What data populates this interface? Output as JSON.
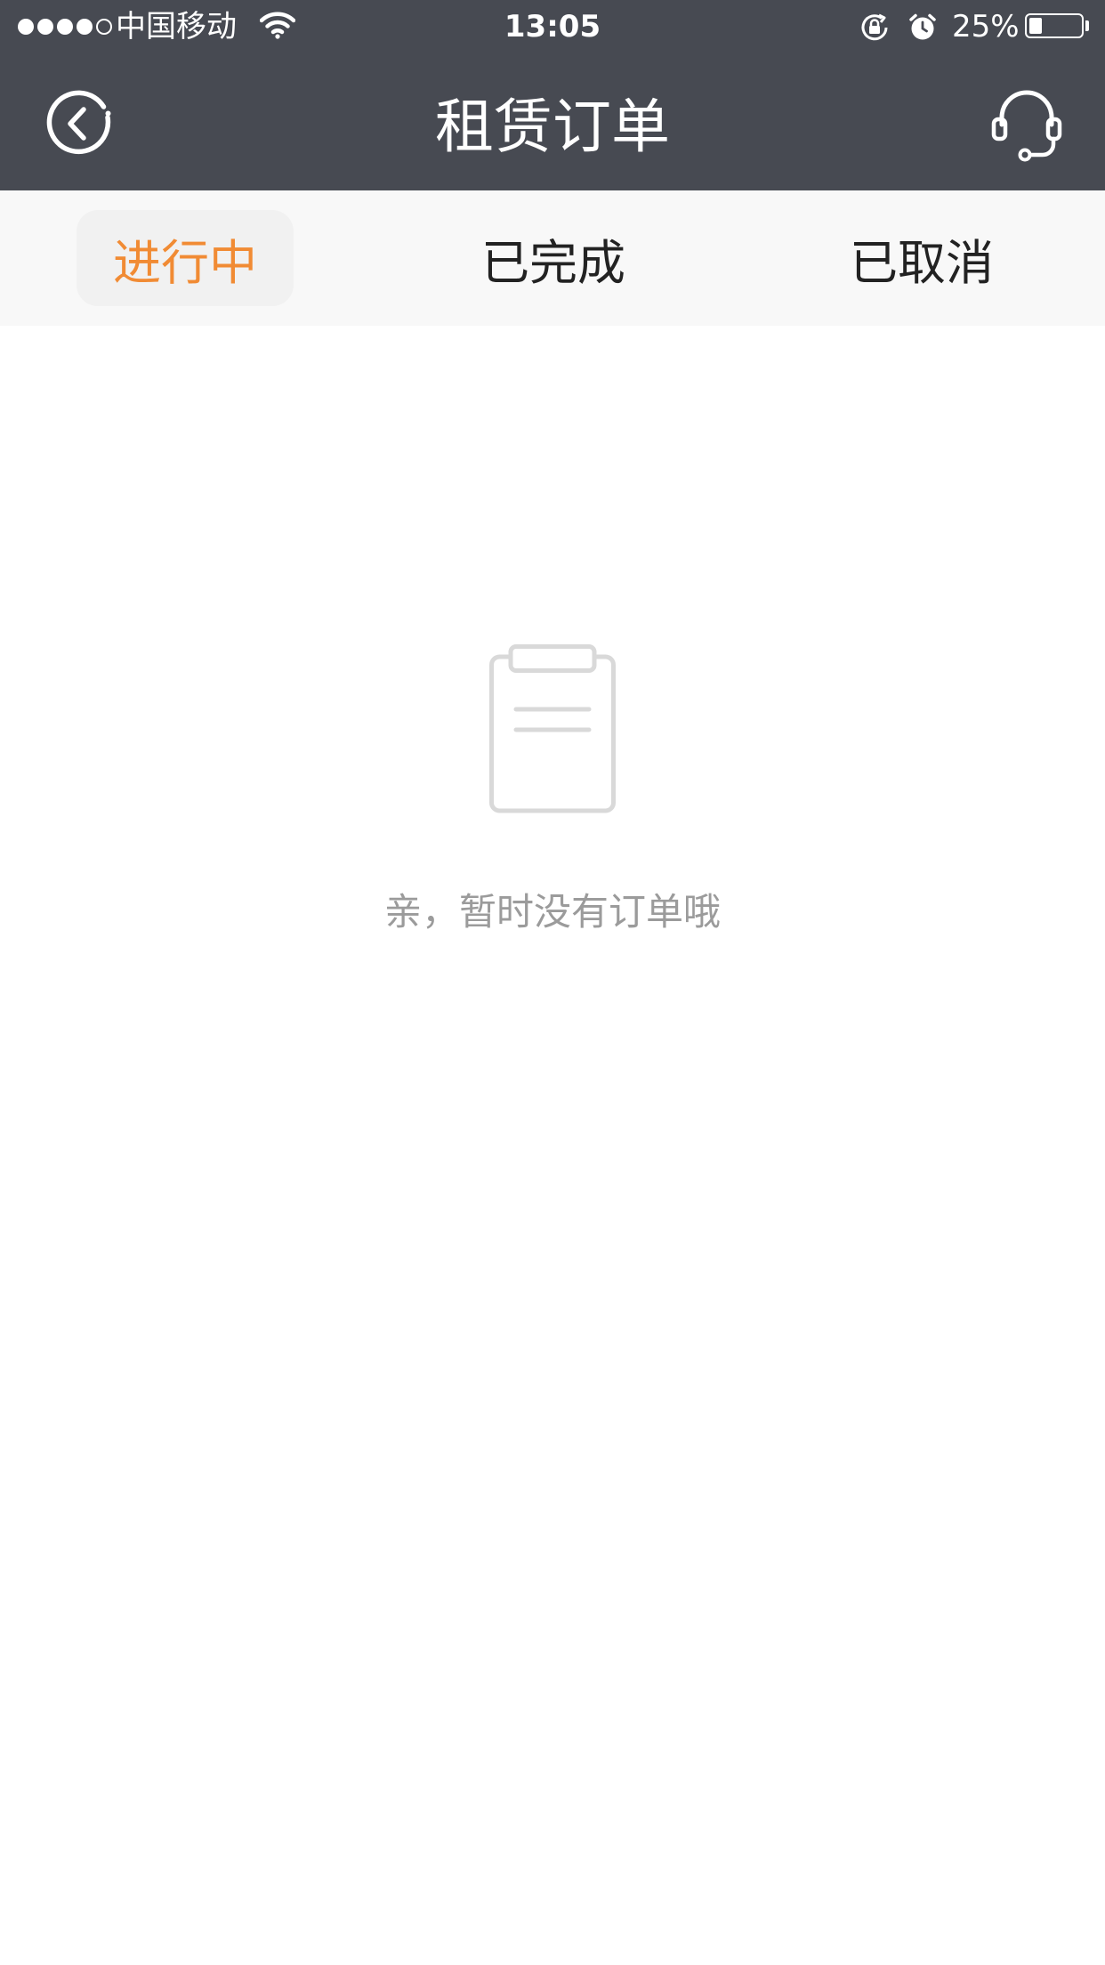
{
  "status_bar": {
    "carrier": "中国移动",
    "time": "13:05",
    "battery_percent": "25%",
    "battery_level": 0.25,
    "signal_bars_filled": 4,
    "signal_bars_total": 5
  },
  "nav": {
    "title": "租赁订单",
    "back_icon": "back-arrow-circle-icon",
    "service_icon": "headset-icon"
  },
  "tabs": [
    {
      "label": "进行中",
      "active": true
    },
    {
      "label": "已完成",
      "active": false
    },
    {
      "label": "已取消",
      "active": false
    }
  ],
  "empty_state": {
    "icon": "clipboard-icon",
    "message": "亲，暂时没有订单哦"
  },
  "colors": {
    "header_bg": "#474a52",
    "accent": "#f18b34",
    "tab_bar_bg": "#f8f8f8",
    "muted_text": "#9b9b9b"
  }
}
